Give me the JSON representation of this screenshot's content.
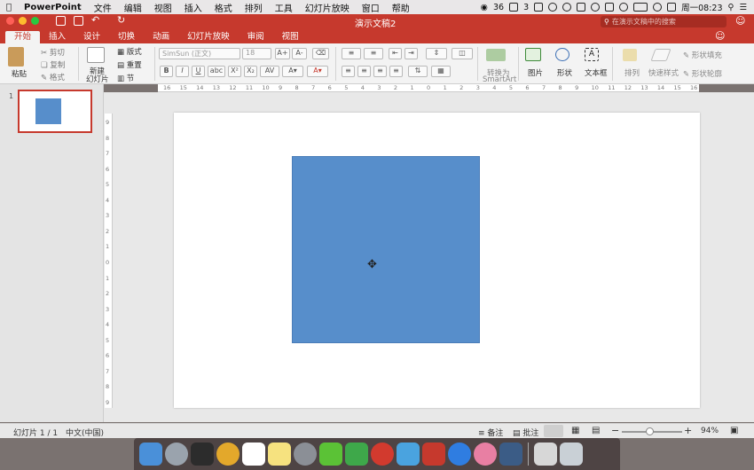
{
  "menubar": {
    "app": "PowerPoint",
    "items": [
      "文件",
      "编辑",
      "视图",
      "插入",
      "格式",
      "排列",
      "工具",
      "幻灯片放映",
      "窗口",
      "帮助"
    ],
    "wechat_count": "36",
    "a_count": "3",
    "clock": "周一08:23"
  },
  "window": {
    "title": "演示文稿2",
    "search_placeholder": "在演示文稿中的搜索"
  },
  "tabs": [
    "开始",
    "插入",
    "设计",
    "切换",
    "动画",
    "幻灯片放映",
    "审阅",
    "视图"
  ],
  "ribbon": {
    "paste": "粘贴",
    "cut": "剪切",
    "copy": "复制",
    "format_painter": "格式",
    "new_slide": "新建",
    "new_slide2": "幻灯片",
    "layout": "版式",
    "reset": "重置",
    "section": "节",
    "font_name": "SimSun (正文)",
    "font_size": "18",
    "bold": "B",
    "italic": "I",
    "underline": "U",
    "strike": "abc",
    "superscript": "X²",
    "subscript": "X₂",
    "smartart": "转换为",
    "smartart2": "SmartArt",
    "picture": "图片",
    "shape": "形状",
    "textbox": "文本框",
    "arrange": "排列",
    "quick_styles": "快速样式",
    "shape_fill": "形状填充",
    "shape_outline": "形状轮廓"
  },
  "ruler_h": [
    "16",
    "15",
    "14",
    "13",
    "12",
    "11",
    "10",
    "9",
    "8",
    "7",
    "6",
    "5",
    "4",
    "3",
    "2",
    "1",
    "0",
    "1",
    "2",
    "3",
    "4",
    "5",
    "6",
    "7",
    "8",
    "9",
    "10",
    "11",
    "12",
    "13",
    "14",
    "15",
    "16"
  ],
  "ruler_v": [
    "9",
    "8",
    "7",
    "6",
    "5",
    "4",
    "3",
    "2",
    "1",
    "0",
    "1",
    "2",
    "3",
    "4",
    "5",
    "6",
    "7",
    "8",
    "9"
  ],
  "slide_panel": {
    "slide_number": "1"
  },
  "status": {
    "slide_info": "幻灯片 1 / 1",
    "language": "中文(中国)",
    "notes": "备注",
    "comments": "批注",
    "zoom_percent": "94%"
  },
  "colors": {
    "ribbon_red": "#c6392d",
    "shape_fill": "#578ecb"
  }
}
